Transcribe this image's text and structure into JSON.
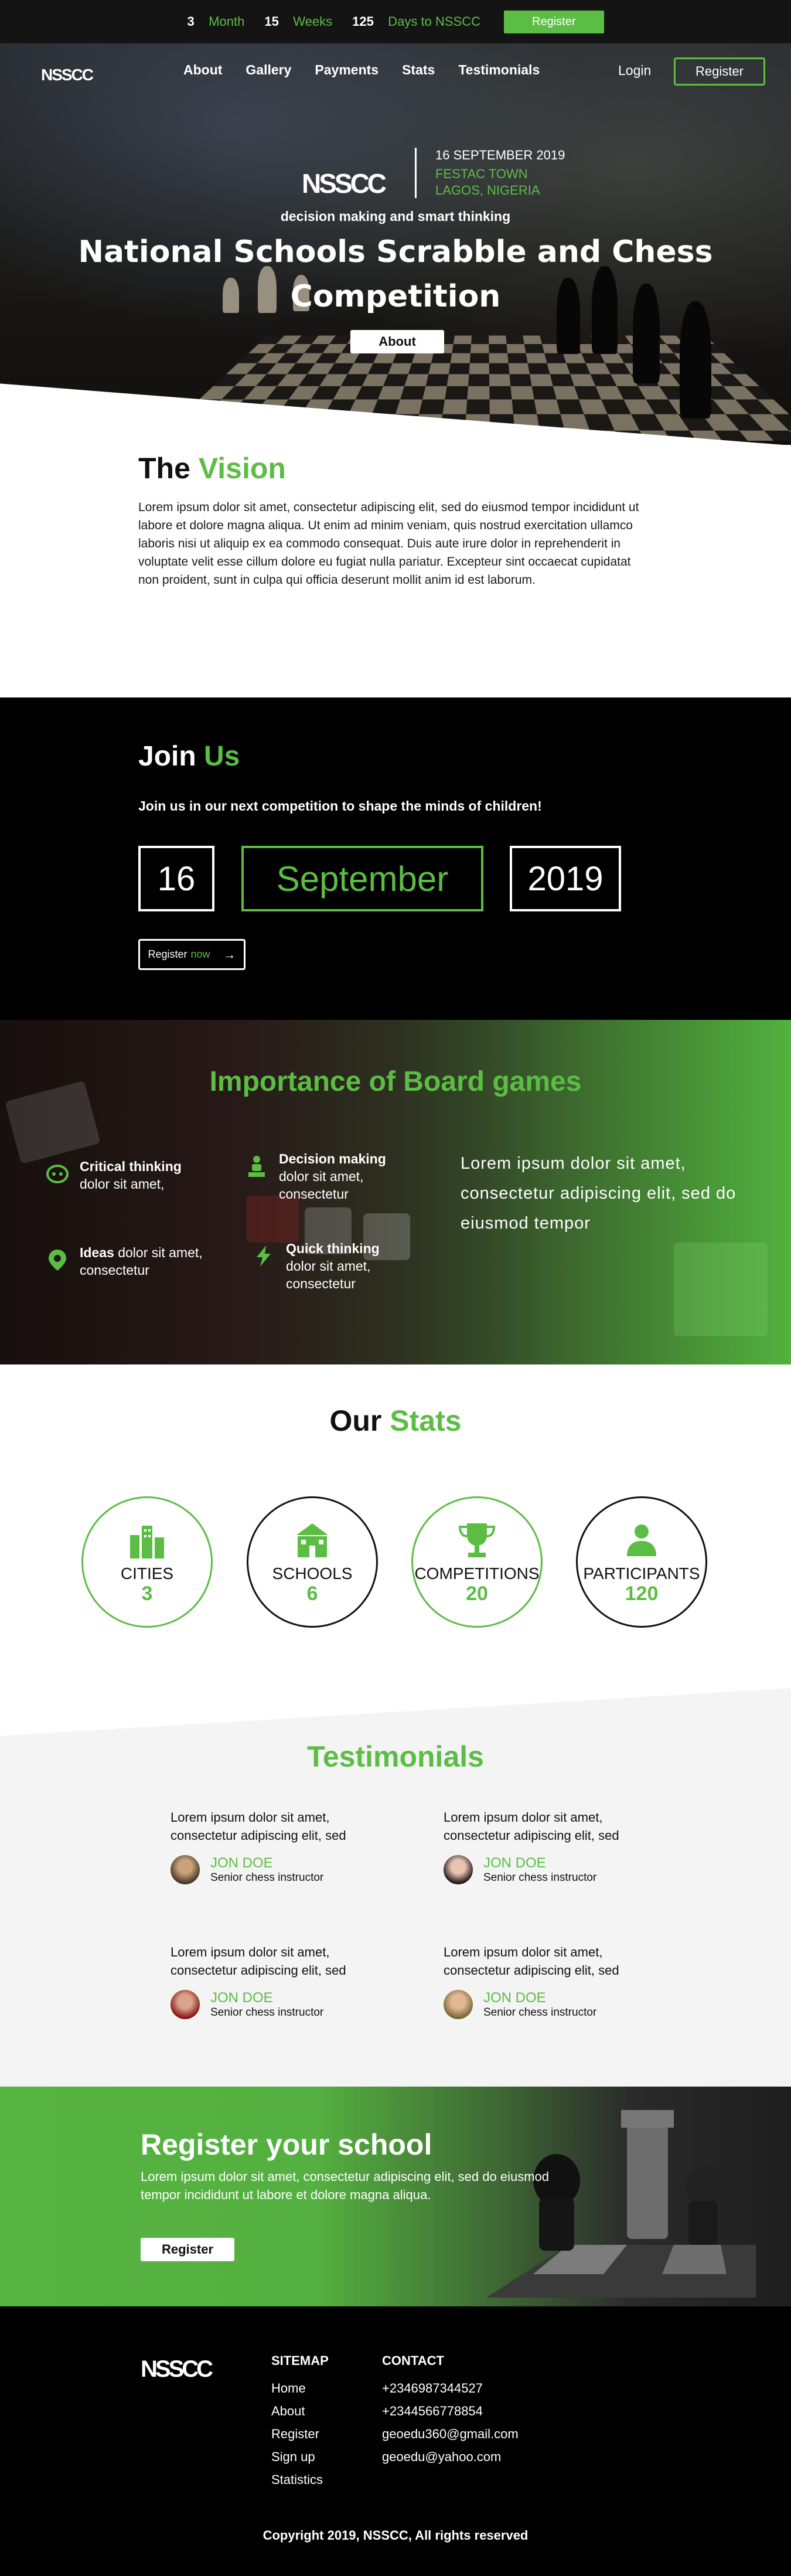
{
  "topbar": {
    "countdown": [
      {
        "num": "3",
        "label": "Month"
      },
      {
        "num": "15",
        "label": "Weeks"
      },
      {
        "num": "125",
        "label": "Days to NSSCC"
      }
    ],
    "register_label": "Register"
  },
  "nav": {
    "logo": "NSSCC",
    "links": [
      "About",
      "Gallery",
      "Payments",
      "Stats",
      "Testimonials"
    ],
    "login_label": "Login",
    "register_label": "Register"
  },
  "hero": {
    "logo": "NSSCC",
    "date": "16 SEPTEMBER 2019",
    "location_line1": "FESTAC TOWN",
    "location_line2": "LAGOS, NIGERIA",
    "tagline": "decision making and smart thinking",
    "title": "National Schools Scrabble and Chess Competition",
    "about_label": "About"
  },
  "vision": {
    "title_black": "The",
    "title_green": "Vision",
    "body": "Lorem ipsum dolor sit amet, consectetur adipiscing elit, sed do eiusmod tempor incididunt ut labore et dolore magna aliqua. Ut enim ad minim veniam, quis nostrud exercitation ullamco laboris nisi ut aliquip ex ea commodo consequat. Duis aute irure dolor in reprehenderit in voluptate velit esse cillum dolore eu fugiat nulla pariatur. Excepteur sint occaecat cupidatat non proident, sunt in culpa qui officia deserunt mollit anim id est laborum."
  },
  "join": {
    "title_white": "Join",
    "title_green": "Us",
    "subtitle": "Join us in our next competition to shape the minds of children!",
    "day": "16",
    "month": "September",
    "year": "2019",
    "register_label": "Register",
    "register_green": "now",
    "arrow": "→"
  },
  "importance": {
    "title_green": "Importance of",
    "title_white": "Board games",
    "features": [
      {
        "icon": "brain-icon",
        "bold": "Critical thinking",
        "text": "dolor sit amet,"
      },
      {
        "icon": "person-presenting-icon",
        "bold": "Decision making",
        "text": "dolor sit amet, consectetur"
      },
      {
        "icon": "lightbulb-icon",
        "bold": "Ideas",
        "text": "dolor sit amet, consectetur"
      },
      {
        "icon": "lightning-icon",
        "bold": "Quick thinking",
        "text": "dolor sit amet, consectetur"
      }
    ],
    "lead": "Lorem ipsum dolor sit amet, consectetur adipiscing elit, sed do eiusmod tempor",
    "accent": "#5cbd45"
  },
  "stats": {
    "title_black": "Our",
    "title_green": "Stats",
    "items": [
      {
        "icon": "city-icon",
        "label": "CITIES",
        "value": "3"
      },
      {
        "icon": "school-icon",
        "label": "SCHOOLS",
        "value": "6"
      },
      {
        "icon": "trophy-icon",
        "label": "COMPETITIONS",
        "value": "20"
      },
      {
        "icon": "participants-icon",
        "label": "PARTICIPANTS",
        "value": "120"
      }
    ]
  },
  "testimonials": {
    "title": "Testimonials",
    "items": [
      {
        "text": "Lorem ipsum dolor sit amet, consectetur adipiscing elit, sed",
        "name": "JON DOE",
        "role": "Senior chess instructor"
      },
      {
        "text": "Lorem ipsum dolor sit amet, consectetur adipiscing elit, sed",
        "name": "JON DOE",
        "role": "Senior chess instructor"
      },
      {
        "text": "Lorem ipsum dolor sit amet, consectetur adipiscing elit, sed",
        "name": "JON DOE",
        "role": "Senior chess instructor"
      },
      {
        "text": "Lorem ipsum dolor sit amet, consectetur adipiscing elit, sed",
        "name": "JON DOE",
        "role": "Senior chess instructor"
      }
    ]
  },
  "register_school": {
    "title": "Register your school",
    "body": "Lorem ipsum dolor sit amet, consectetur adipiscing elit, sed do eiusmod tempor incididunt ut labore et dolore magna aliqua.",
    "button": "Register"
  },
  "footer": {
    "logo": "NSSCC",
    "sitemap_title": "SITEMAP",
    "sitemap": [
      "Home",
      "About",
      "Register",
      "Sign up",
      "Statistics"
    ],
    "contact_title": "CONTACT",
    "contact": [
      "+2346987344527",
      "+2344566778854",
      "geoedu360@gmail.com",
      "geoedu@yahoo.com"
    ],
    "copyright": "Copyright 2019, NSSCC, All rights reserved"
  }
}
